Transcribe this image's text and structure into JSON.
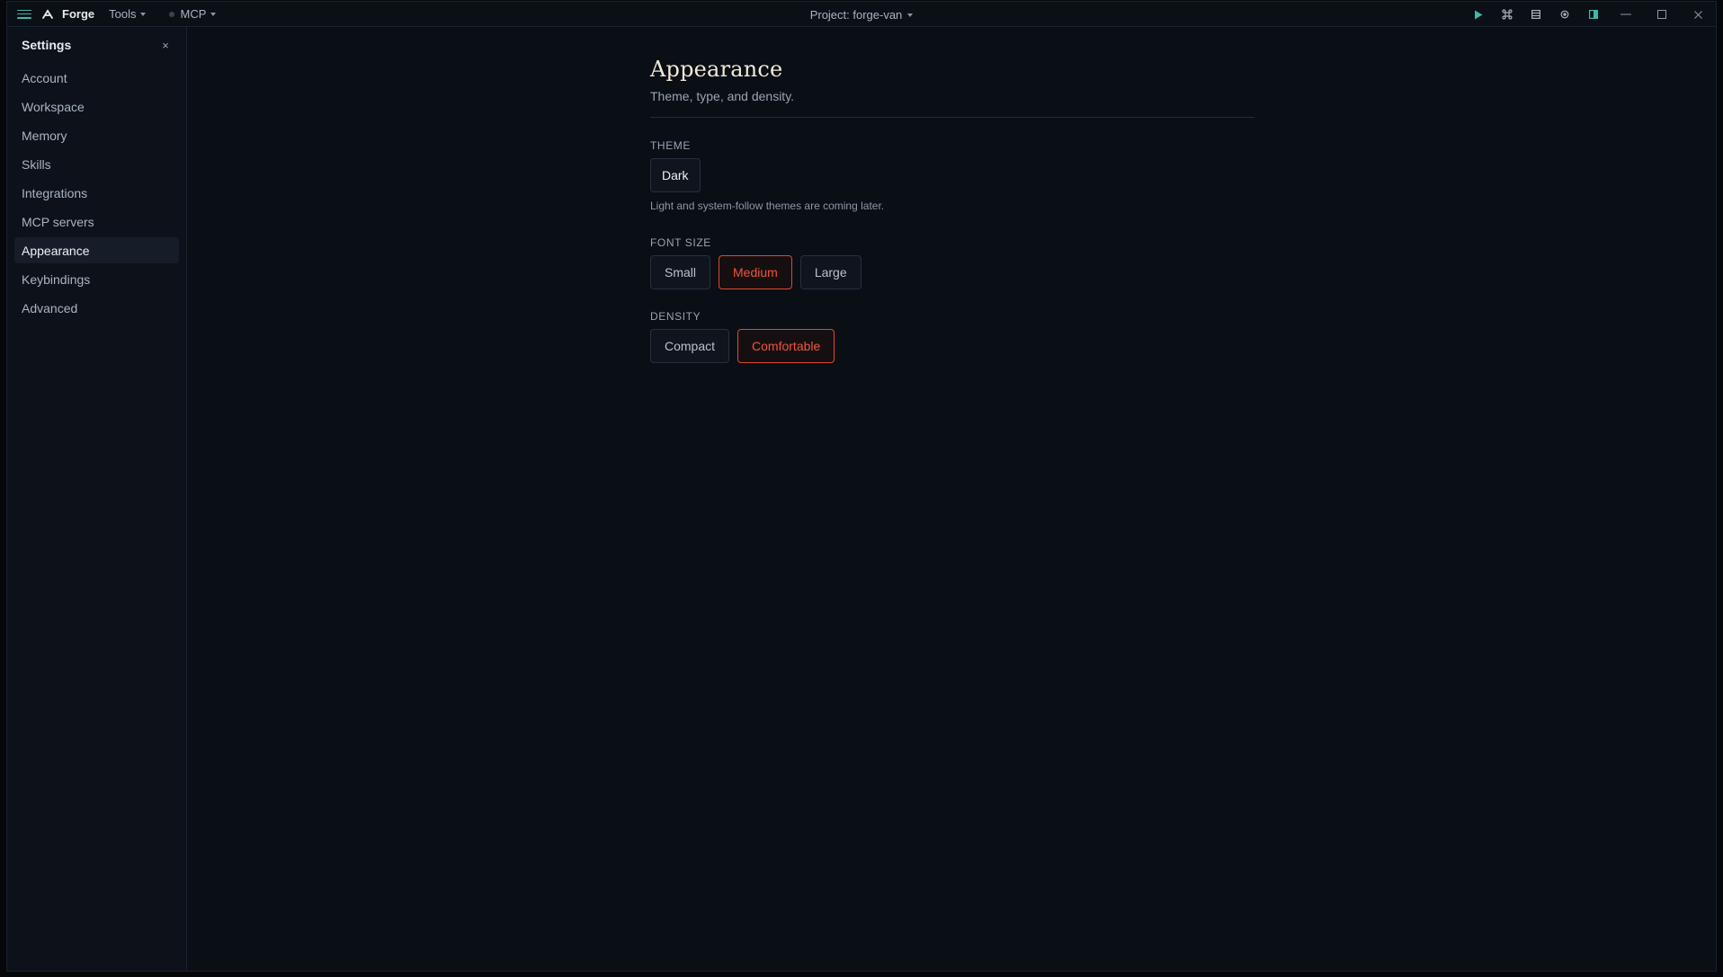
{
  "titlebar": {
    "app_name": "Forge",
    "menus": [
      {
        "label": "Tools"
      },
      {
        "label": "MCP"
      }
    ],
    "project_label": "Project: forge-van"
  },
  "sidebar": {
    "title": "Settings",
    "close_label": "×",
    "items": [
      {
        "label": "Account"
      },
      {
        "label": "Workspace"
      },
      {
        "label": "Memory"
      },
      {
        "label": "Skills"
      },
      {
        "label": "Integrations"
      },
      {
        "label": "MCP servers"
      },
      {
        "label": "Appearance"
      },
      {
        "label": "Keybindings"
      },
      {
        "label": "Advanced"
      }
    ],
    "active_index": 6
  },
  "main": {
    "title": "Appearance",
    "subtitle": "Theme, type, and density.",
    "theme": {
      "label": "THEME",
      "options": [
        {
          "label": "Dark"
        }
      ],
      "help": "Light and system-follow themes are coming later."
    },
    "font_size": {
      "label": "FONT SIZE",
      "options": [
        {
          "label": "Small"
        },
        {
          "label": "Medium"
        },
        {
          "label": "Large"
        }
      ],
      "selected": "Medium"
    },
    "density": {
      "label": "DENSITY",
      "options": [
        {
          "label": "Compact"
        },
        {
          "label": "Comfortable"
        }
      ],
      "selected": "Comfortable"
    }
  },
  "colors": {
    "accent": "#e0472f",
    "teal": "#3fb8a6",
    "background": "#0a0e15",
    "sidebar": "#0c111a",
    "title_text": "#f1e9d8"
  },
  "icons": {
    "titlebar_right": [
      "play-icon",
      "command-icon",
      "list-icon",
      "circle-icon",
      "split-panel-icon"
    ],
    "window_controls": [
      "minimize-icon",
      "maximize-icon",
      "close-icon"
    ]
  }
}
